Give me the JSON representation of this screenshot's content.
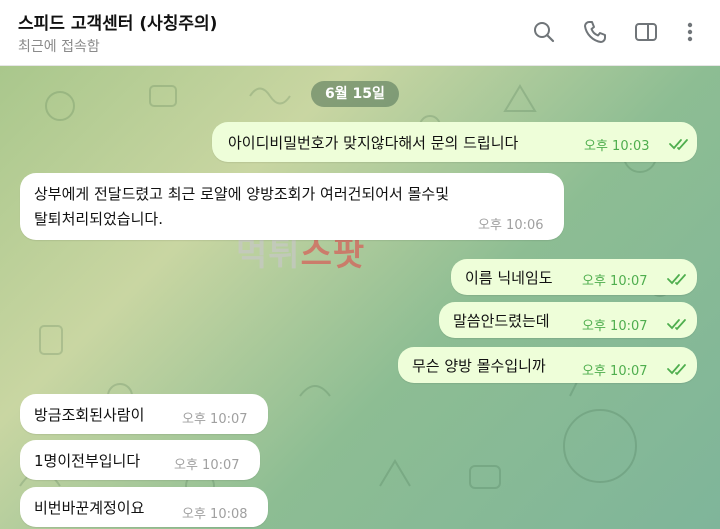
{
  "header": {
    "title": "스피드 고객센터 (사칭주의)",
    "status": "최근에 접속함",
    "icons": [
      "search-icon",
      "phone-icon",
      "sidebar-toggle-icon",
      "more-vertical-icon"
    ]
  },
  "chat": {
    "date_label": "6월 15일",
    "watermark_part1": "먹튀",
    "watermark_part2": "스팟",
    "messages": [
      {
        "dir": "out",
        "text": "아이디비밀번호가 맞지않다해서 문의 드립니다",
        "time": "오후 10:03",
        "read": true
      },
      {
        "dir": "in",
        "text_line1": "상부에게 전달드렸고 최근 로얄에 양방조회가 여러건되어서 몰수및",
        "text_line2": "탈퇴처리되었습니다.",
        "time": "오후 10:06"
      },
      {
        "dir": "out",
        "text": "이름 닉네임도",
        "time": "오후 10:07",
        "read": true
      },
      {
        "dir": "out",
        "text": "말씀안드렸는데",
        "time": "오후 10:07",
        "read": true
      },
      {
        "dir": "out",
        "text": "무슨 양방 몰수입니까",
        "time": "오후 10:07",
        "read": true
      },
      {
        "dir": "in",
        "text": "방금조회된사람이",
        "time": "오후 10:07"
      },
      {
        "dir": "in",
        "text": "1명이전부입니다",
        "time": "오후 10:07"
      },
      {
        "dir": "in",
        "text": "비번바꾼계정이요",
        "time": "오후 10:08"
      }
    ]
  },
  "colors": {
    "outgoing_bubble": "#eefed9",
    "incoming_bubble": "#ffffff",
    "read_check": "#4fae4e",
    "header_bg": "#ffffff"
  }
}
